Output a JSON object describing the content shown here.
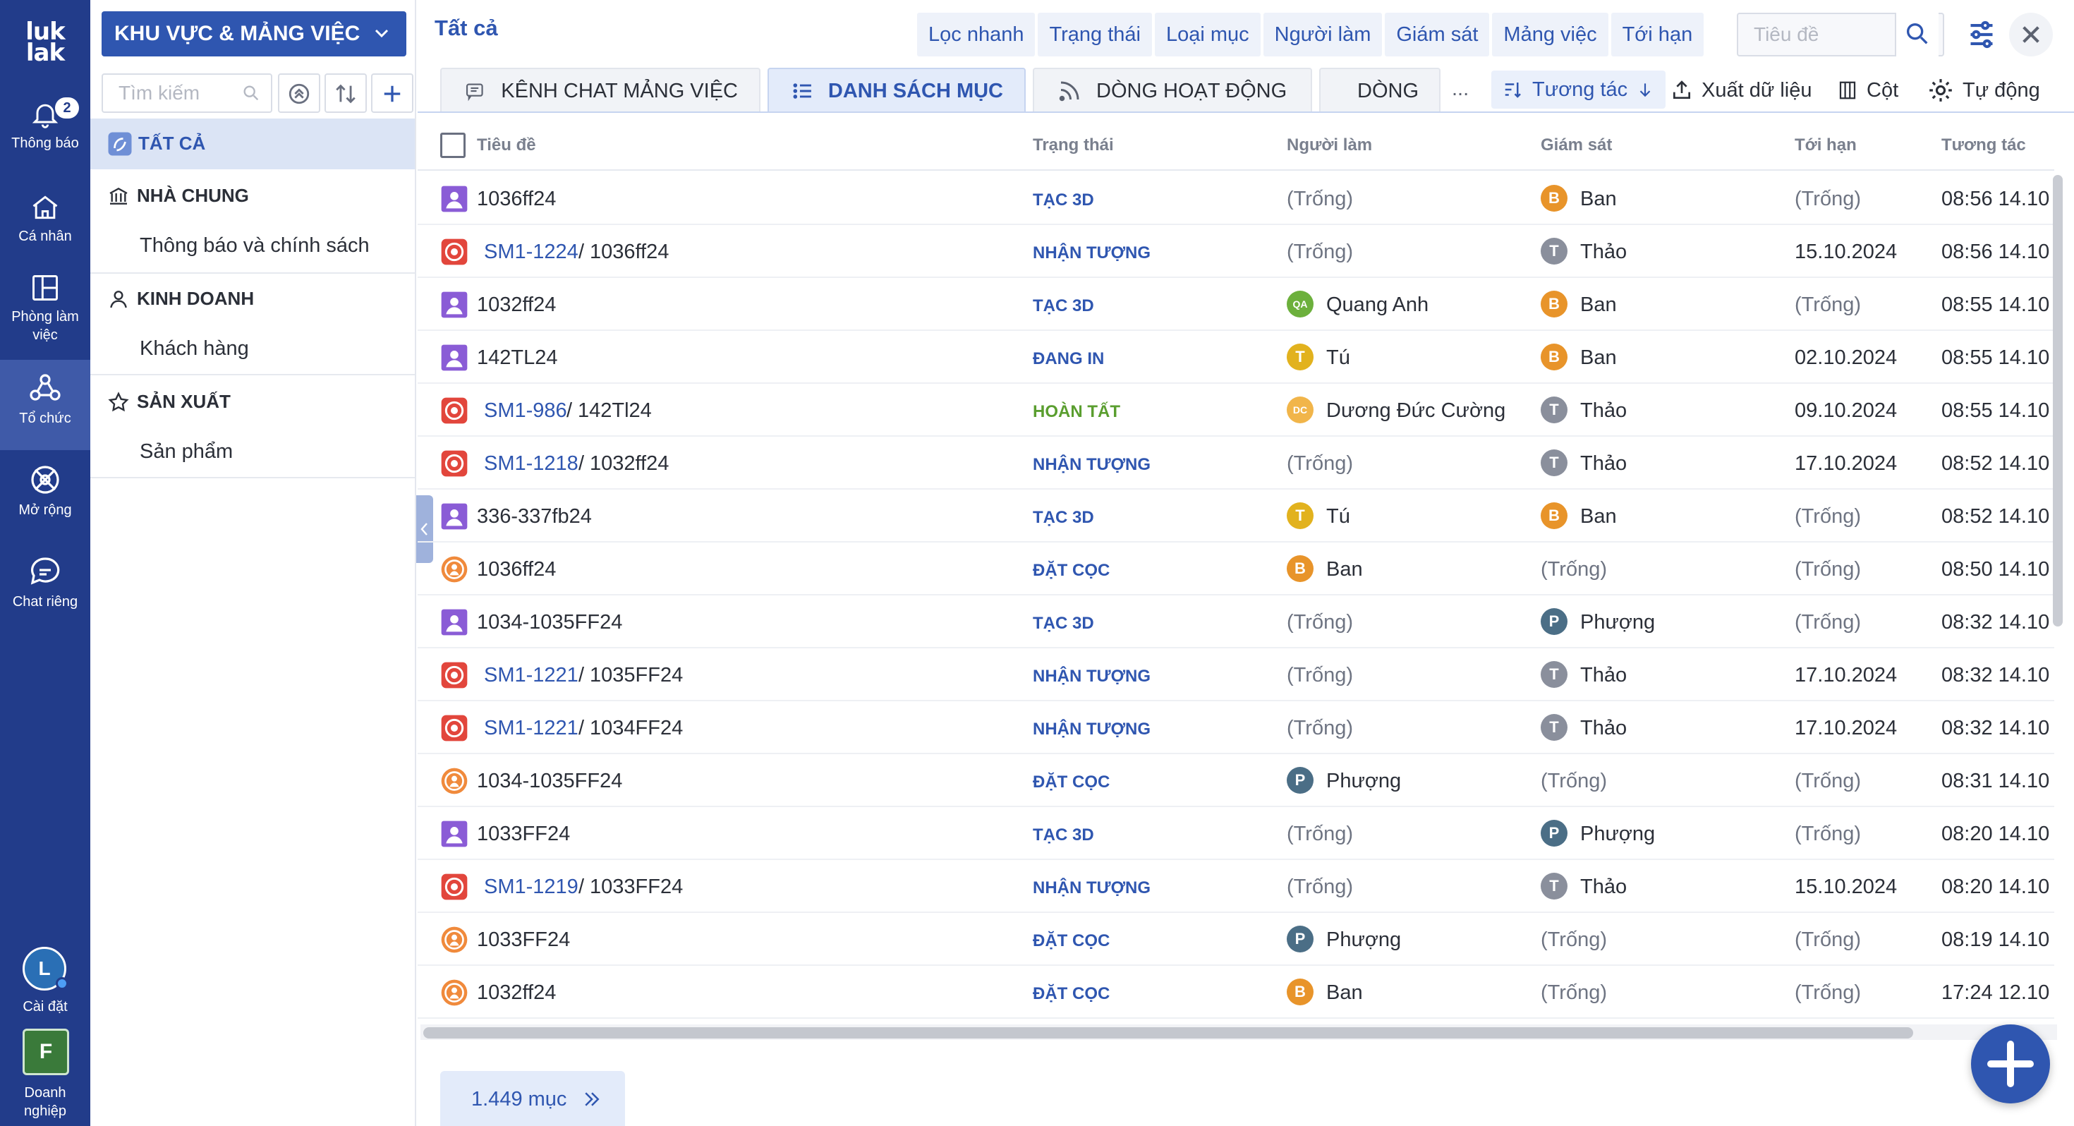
{
  "rail": {
    "logo_top": "luk",
    "logo_bottom": "lak",
    "notification_count": "2",
    "items": [
      {
        "label": "Thông báo",
        "icon": "bell-icon"
      },
      {
        "label": "Cá nhân",
        "icon": "home-icon"
      },
      {
        "label": "Phòng làm việc",
        "icon": "layout-icon"
      },
      {
        "label": "Tổ chức",
        "icon": "organization-icon"
      },
      {
        "label": "Mở rộng",
        "icon": "extensions-icon"
      },
      {
        "label": "Chat riêng",
        "icon": "chat-icon"
      }
    ],
    "user_initial": "L",
    "settings_label": "Cài đặt",
    "company_initial": "F",
    "company_label": "Doanh nghiệp"
  },
  "tree": {
    "workspace_label": "KHU VỰC & MẢNG VIỆC",
    "search_placeholder": "Tìm kiếm",
    "all_label": "TẤT CẢ",
    "sections": [
      {
        "label": "NHÀ CHUNG",
        "icon": "bank-icon",
        "children": [
          "Thông báo và chính sách"
        ]
      },
      {
        "label": "KINH DOANH",
        "icon": "person-icon",
        "children": [
          "Khách hàng"
        ]
      },
      {
        "label": "SẢN XUẤT",
        "icon": "star-icon",
        "children": [
          "Sản phẩm"
        ]
      }
    ]
  },
  "header": {
    "breadcrumb": "Tất cả",
    "filters": [
      "Lọc nhanh",
      "Trạng thái",
      "Loại mục",
      "Người làm",
      "Giám sát",
      "Mảng việc",
      "Tới hạn"
    ],
    "title_search_placeholder": "Tiêu đề"
  },
  "tabs": [
    {
      "label": "KÊNH CHAT MẢNG VIỆC",
      "icon": "chat-channel-icon"
    },
    {
      "label": "DANH SÁCH MỤC",
      "icon": "list-icon",
      "active": true
    },
    {
      "label": "DÒNG HOẠT ĐỘNG",
      "icon": "feed-icon"
    },
    {
      "label": "DÒNG",
      "icon": "timeline-icon"
    }
  ],
  "tabs_more": "...",
  "toolbar": {
    "sort_label": "Tương tác",
    "export_label": "Xuất dữ liệu",
    "columns_label": "Cột",
    "auto_label": "Tự động"
  },
  "table": {
    "columns": [
      "Tiêu đề",
      "Trạng thái",
      "Người làm",
      "Giám sát",
      "Tới hạn",
      "Tương tác"
    ],
    "rows": [
      {
        "type": "purple",
        "code": "",
        "title": "1036ff24",
        "status": "TẠC 3D",
        "status_color": "#2f56b0",
        "assignee": "(Trống)",
        "assignee_av": "",
        "supervisor": "Ban",
        "supervisor_av": "B",
        "due": "(Trống)",
        "updated": "08:56 14.10"
      },
      {
        "type": "red",
        "code": "SM1-1224",
        "title": "1036ff24",
        "status": "NHẬN TƯỢNG",
        "status_color": "#2f56b0",
        "assignee": "(Trống)",
        "assignee_av": "",
        "supervisor": "Thảo",
        "supervisor_av": "T",
        "due": "15.10.2024",
        "updated": "08:56 14.10"
      },
      {
        "type": "purple",
        "code": "",
        "title": "1032ff24",
        "status": "TẠC 3D",
        "status_color": "#2f56b0",
        "assignee": "Quang Anh",
        "assignee_av": "QA",
        "supervisor": "Ban",
        "supervisor_av": "B",
        "due": "(Trống)",
        "updated": "08:55 14.10"
      },
      {
        "type": "purple",
        "code": "",
        "title": "142TL24",
        "status": "ĐANG IN",
        "status_color": "#2f56b0",
        "assignee": "Tú",
        "assignee_av": "T",
        "supervisor": "Ban",
        "supervisor_av": "B",
        "due": "02.10.2024",
        "updated": "08:55 14.10"
      },
      {
        "type": "red",
        "code": "SM1-986",
        "title": "142Tl24",
        "status": "HOÀN TẤT",
        "status_color": "#5a9e2f",
        "assignee": "Dương Đức Cường",
        "assignee_av": "DC",
        "supervisor": "Thảo",
        "supervisor_av": "T",
        "due": "09.10.2024",
        "updated": "08:55 14.10"
      },
      {
        "type": "red",
        "code": "SM1-1218",
        "title": "1032ff24",
        "status": "NHẬN TƯỢNG",
        "status_color": "#2f56b0",
        "assignee": "(Trống)",
        "assignee_av": "",
        "supervisor": "Thảo",
        "supervisor_av": "T",
        "due": "17.10.2024",
        "updated": "08:52 14.10"
      },
      {
        "type": "purple",
        "code": "",
        "title": "336-337fb24",
        "status": "TẠC 3D",
        "status_color": "#2f56b0",
        "assignee": "Tú",
        "assignee_av": "T",
        "supervisor": "Ban",
        "supervisor_av": "B",
        "due": "(Trống)",
        "updated": "08:52 14.10"
      },
      {
        "type": "orange",
        "code": "",
        "title": "1036ff24",
        "status": "ĐẶT CỌC",
        "status_color": "#2f56b0",
        "assignee": "Ban",
        "assignee_av": "B",
        "supervisor": "(Trống)",
        "supervisor_av": "",
        "due": "(Trống)",
        "updated": "08:50 14.10"
      },
      {
        "type": "purple",
        "code": "",
        "title": "1034-1035FF24",
        "status": "TẠC 3D",
        "status_color": "#2f56b0",
        "assignee": "(Trống)",
        "assignee_av": "",
        "supervisor": "Phượng",
        "supervisor_av": "P",
        "due": "(Trống)",
        "updated": "08:32 14.10"
      },
      {
        "type": "red",
        "code": "SM1-1221",
        "title": "1035FF24",
        "status": "NHẬN TƯỢNG",
        "status_color": "#2f56b0",
        "assignee": "(Trống)",
        "assignee_av": "",
        "supervisor": "Thảo",
        "supervisor_av": "T",
        "due": "17.10.2024",
        "updated": "08:32 14.10"
      },
      {
        "type": "red",
        "code": "SM1-1221",
        "title": "1034FF24",
        "status": "NHẬN TƯỢNG",
        "status_color": "#2f56b0",
        "assignee": "(Trống)",
        "assignee_av": "",
        "supervisor": "Thảo",
        "supervisor_av": "T",
        "due": "17.10.2024",
        "updated": "08:32 14.10"
      },
      {
        "type": "orange",
        "code": "",
        "title": "1034-1035FF24",
        "status": "ĐẶT CỌC",
        "status_color": "#2f56b0",
        "assignee": "Phượng",
        "assignee_av": "P",
        "supervisor": "(Trống)",
        "supervisor_av": "",
        "due": "(Trống)",
        "updated": "08:31 14.10"
      },
      {
        "type": "purple",
        "code": "",
        "title": "1033FF24",
        "status": "TẠC 3D",
        "status_color": "#2f56b0",
        "assignee": "(Trống)",
        "assignee_av": "",
        "supervisor": "Phượng",
        "supervisor_av": "P",
        "due": "(Trống)",
        "updated": "08:20 14.10"
      },
      {
        "type": "red",
        "code": "SM1-1219",
        "title": "1033FF24",
        "status": "NHẬN TƯỢNG",
        "status_color": "#2f56b0",
        "assignee": "(Trống)",
        "assignee_av": "",
        "supervisor": "Thảo",
        "supervisor_av": "T",
        "due": "15.10.2024",
        "updated": "08:20 14.10"
      },
      {
        "type": "orange",
        "code": "",
        "title": "1033FF24",
        "status": "ĐẶT CỌC",
        "status_color": "#2f56b0",
        "assignee": "Phượng",
        "assignee_av": "P",
        "supervisor": "(Trống)",
        "supervisor_av": "",
        "due": "(Trống)",
        "updated": "08:19 14.10"
      },
      {
        "type": "orange",
        "code": "",
        "title": "1032ff24",
        "status": "ĐẶT CỌC",
        "status_color": "#2f56b0",
        "assignee": "Ban",
        "assignee_av": "B",
        "supervisor": "(Trống)",
        "supervisor_av": "",
        "due": "(Trống)",
        "updated": "17:24 12.10"
      }
    ]
  },
  "footer": {
    "count_label": "1.449 mục"
  },
  "colors": {
    "rail": "#223c8a",
    "accent": "#2f56b0",
    "done": "#5a9e2f",
    "ban": "#e8942a",
    "thao": "#8a8f9c",
    "tu": "#e2b21e"
  }
}
